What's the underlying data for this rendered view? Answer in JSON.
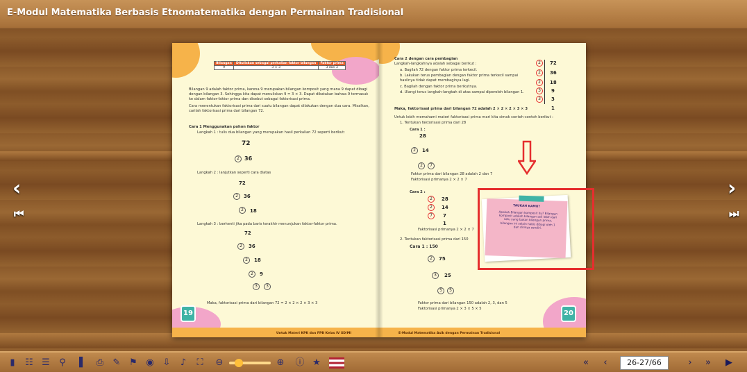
{
  "app": {
    "title": "E-Modul Matematika Berbasis Etnomatematika dengan Permainan Tradisional"
  },
  "left_page": {
    "table": {
      "headers": [
        "Bilangan",
        "Dituliskan sebagai perkalian faktor bilangan",
        "Faktor prima"
      ],
      "row": [
        "9",
        "3 × 3",
        "3 dan 3"
      ]
    },
    "para1": "Bilangan 9 adalah faktor prima, karena 9 merupakan bilangan komposit yang mana 9 dapat dibagi dengan bilangan 3. Sehingga kita dapat menuliskan 9 = 3 × 3. Dapat dikatakan bahwa 9 termasuk ke dalam faktor-faktor prima dan disebut sebagai faktorisasi prima.",
    "para2": "Cara menentukan faktorisasi prima dari suatu bilangan dapat dilakukan dengan dua cara. Misalkan, carilah faktorisasi prima dari bilangan 72.",
    "cara1_title": "Cara 1 Menggunakan pohon faktor",
    "step1": "Langkah 1 : tulis dua bilangan yang merupakan hasil perkalian 72  seperti berikut:",
    "step2": "Langkah 2 : lanjutkan seperti cara diatas",
    "step3": "Langkah 3 : berhenti jika pada baris terakhir menunjukan faktor-faktor prima.",
    "conclusion": "Maka, faktorisasi prima dari bilangan 72 = 2 × 2 × 2 × 3 × 3",
    "tree_nums": [
      "72",
      "2",
      "36",
      "18",
      "9",
      "3",
      "3"
    ],
    "page_number": "19",
    "footer": "Untuk Materi KPK dan FPB Kelas IV SD/MI"
  },
  "right_page": {
    "cara2_title": "Cara 2 dengan cara pembagian",
    "cara2_intro": "Langkah-langkahnya adalah sebagai berikut :",
    "steps": [
      "a. Bagilah 72 dengan faktor prima terkecil.",
      "b. Lakukan terus pembagian dengan faktor prima terkecil sampai hasilnya tidak dapat membaginya lagi.",
      "c. Bagilah dengan faktor prima berikutnya.",
      "d. Ulangi terus langkah-langkah di atas sampai diperoleh bilangan 1."
    ],
    "division": {
      "divisors": [
        "2",
        "2",
        "2",
        "3",
        "3"
      ],
      "values": [
        "72",
        "36",
        "18",
        "9",
        "3",
        "1"
      ]
    },
    "maka": "Maka, faktorisasi prima dari bilangan 72 adalah 2 × 2 × 2 × 3 × 3",
    "untuk": "Untuk lebih memahami materi faktorisasi prima mari kita simak contoh-contoh berikut :",
    "ex1_title": "1. Tentukan faktorisasi prima dari 28",
    "cara1": "Cara 1 :",
    "ex1_tree": [
      "28",
      "2",
      "14",
      "2",
      "7"
    ],
    "ex1_res1": "Faktor prima dari bilangan 28 adalah 2 dan 7",
    "ex1_res2": "Faktorisasi primanya 2 × 2 × 7",
    "cara2": "Cara 2 :",
    "ex1_div": {
      "divisors": [
        "2",
        "2",
        "7"
      ],
      "values": [
        "28",
        "14",
        "7",
        "1"
      ]
    },
    "ex1_res3": "Faktorisasi primanya 2 × 2 × 7",
    "ex2_title": "2. Tentukan faktorisasi prima dari 150",
    "ex2_cara1": "Cara 1 : 150",
    "ex2_tree": [
      "2",
      "75",
      "3",
      "25",
      "5",
      "5"
    ],
    "ex2_res1": "Faktor prima dari bilangan 150 adalah  2, 3, dan 5",
    "ex2_res2": "Faktorisasi primanya 2 × 3 × 5 × 5",
    "note_title": "TAUKAH KAMU?",
    "note_text": "Apakah Bilangan komposit itu? Bilangan komposit adalah bilangan asli lebih dari satu yang bukan bilangan prima, bilangan ini selain habis dibagi oleh 1 dan dirinya sendiri.",
    "page_number": "20",
    "footer": "E-Modul Matematika Asik dengan Permainan Tradisional"
  },
  "toolbar": {
    "page_indicator": "26-27/66"
  },
  "colors": {
    "accent": "#e52e2e",
    "teal": "#3fb3a6",
    "orange": "#f6b34a",
    "pink": "#f2a6c9"
  }
}
